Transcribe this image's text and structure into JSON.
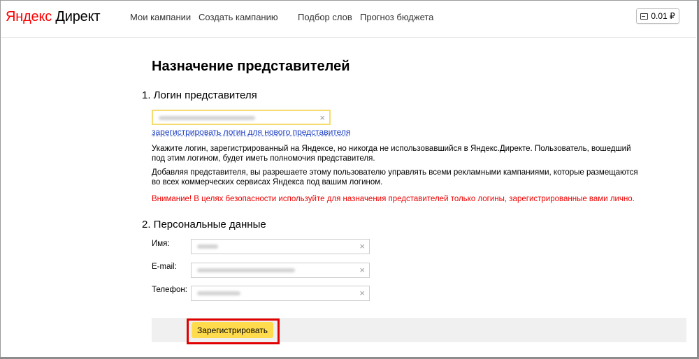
{
  "header": {
    "logo_ya": "Яндекс",
    "logo_rest": " Директ",
    "nav": [
      "Мои кампании",
      "Создать кампанию",
      "Подбор слов",
      "Прогноз бюджета"
    ],
    "balance": "0.01 ₽"
  },
  "page": {
    "title": "Назначение представителей",
    "section1_title": "1. Логин представителя",
    "register_link": "зарегистрировать логин для нового представителя",
    "para1": "Укажите логин, зарегистрированный на Яндексе, но никогда не использовавшийся в Яндекс.Директе. Пользователь, вошедший под этим логином, будет иметь полномочия представителя.",
    "para2": "Добавляя представителя, вы разрешаете этому пользователю управлять всеми рекламными кампаниями, которые размещаются во всех коммерческих сервисах Яндекса под вашим логином.",
    "warning": "Внимание! В целях безопасности используйте для назначения представителей только логины, зарегистрированные вами лично.",
    "section2_title": "2. Персональные данные",
    "name_label": "Имя:",
    "email_label": "E-mail:",
    "phone_label": "Телефон:",
    "clear_glyph": "×",
    "submit_label": "Зарегистрировать"
  },
  "colors": {
    "logo_red": "#ff0000",
    "link_blue": "#1a3dc1",
    "warning_red": "#e00000",
    "button_yellow": "#ffdb4d",
    "focus_yellow": "#f5dc6e"
  }
}
